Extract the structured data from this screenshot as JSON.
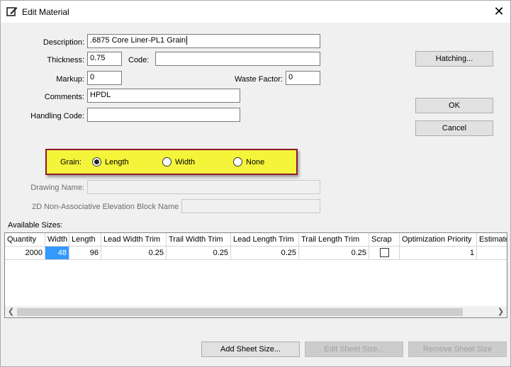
{
  "window": {
    "title": "Edit Material",
    "close_glyph": "✕"
  },
  "form": {
    "description_label": "Description:",
    "description_value": ".6875 Core Liner-PL1 Grain",
    "thickness_label": "Thickness:",
    "thickness_value": "0.75",
    "code_label": "Code:",
    "code_value": "",
    "markup_label": "Markup:",
    "markup_value": "0",
    "waste_label": "Waste Factor:",
    "waste_value": "0",
    "comments_label": "Comments:",
    "comments_value": "HPDL",
    "handling_label": "Handling Code:",
    "handling_value": "",
    "drawing_name_label": "Drawing Name:",
    "drawing_name_value": "",
    "block_name_label": "2D Non-Associative Elevation Block Name",
    "block_name_value": ""
  },
  "grain": {
    "label": "Grain:",
    "options": [
      {
        "label": "Length",
        "selected": true
      },
      {
        "label": "Width",
        "selected": false
      },
      {
        "label": "None",
        "selected": false
      }
    ]
  },
  "buttons": {
    "hatching": "Hatching...",
    "ok": "OK",
    "cancel": "Cancel",
    "add_sheet": "Add Sheet Size...",
    "edit_sheet": "Edit Sheet Size...",
    "remove_sheet": "Remove Sheet Size"
  },
  "sizes": {
    "label": "Available Sizes:",
    "columns": [
      "Quantity",
      "Width",
      "Length",
      "Lead Width Trim",
      "Trail Width Trim",
      "Lead Length Trim",
      "Trail Length Trim",
      "Scrap",
      "Optimization Priority",
      "Estimated"
    ],
    "rows": [
      {
        "quantity": "2000",
        "width": "48",
        "length": "96",
        "lead_width_trim": "0.25",
        "trail_width_trim": "0.25",
        "lead_length_trim": "0.25",
        "trail_length_trim": "0.25",
        "scrap": false,
        "optimization_priority": "1",
        "estimated": ""
      }
    ]
  },
  "colors": {
    "highlight": "#f4f43a",
    "highlight_border": "#8a1a2a",
    "selection": "#3399ff"
  },
  "icons": {
    "title": "edit-material-icon",
    "scroll_left": "chevron-left-icon",
    "scroll_right": "chevron-right-icon"
  }
}
